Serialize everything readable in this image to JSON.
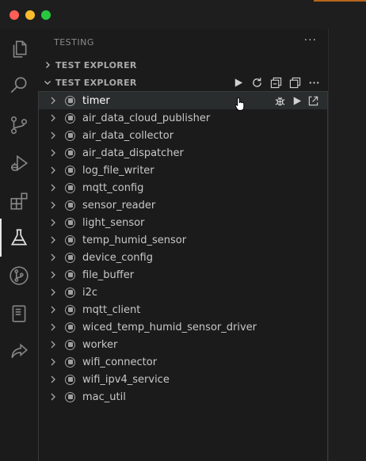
{
  "window": {
    "traffic_lights": [
      "close",
      "minimize",
      "maximize"
    ],
    "colors": {
      "close": "#ff5f57",
      "minimize": "#febc2e",
      "maximize": "#28c840"
    }
  },
  "activity_bar": {
    "items": [
      {
        "icon": "files-icon",
        "active": false
      },
      {
        "icon": "search-icon",
        "active": false
      },
      {
        "icon": "source-control-icon",
        "active": false
      },
      {
        "icon": "run-debug-icon",
        "active": false
      },
      {
        "icon": "extensions-icon",
        "active": false
      },
      {
        "icon": "testing-flask-icon",
        "active": true
      },
      {
        "icon": "git-graph-icon",
        "active": false
      },
      {
        "icon": "notebook-icon",
        "active": false
      },
      {
        "icon": "live-share-icon",
        "active": false
      }
    ]
  },
  "sidebar": {
    "title": "TESTING",
    "more": "···",
    "sections": [
      {
        "label": "TEST EXPLORER",
        "expanded": false
      },
      {
        "label": "TEST EXPLORER",
        "expanded": true
      }
    ],
    "section_actions": [
      "run-icon",
      "refresh-icon",
      "collapse-all-icon",
      "show-output-icon",
      "more-actions-icon"
    ],
    "more_actions": "···",
    "tests": [
      {
        "name": "timer",
        "selected": true
      },
      {
        "name": "air_data_cloud_publisher"
      },
      {
        "name": "air_data_collector"
      },
      {
        "name": "air_data_dispatcher"
      },
      {
        "name": "log_file_writer"
      },
      {
        "name": "mqtt_config"
      },
      {
        "name": "sensor_reader"
      },
      {
        "name": "light_sensor"
      },
      {
        "name": "temp_humid_sensor"
      },
      {
        "name": "device_config"
      },
      {
        "name": "file_buffer"
      },
      {
        "name": "i2c"
      },
      {
        "name": "mqtt_client"
      },
      {
        "name": "wiced_temp_humid_sensor_driver"
      },
      {
        "name": "worker"
      },
      {
        "name": "wifi_connector"
      },
      {
        "name": "wifi_ipv4_service"
      },
      {
        "name": "mac_util"
      }
    ],
    "row_actions": [
      "debug-test-icon",
      "run-test-icon",
      "go-to-test-icon"
    ]
  },
  "colors": {
    "accent": "#b5651d",
    "selected_row": "#2a2d2e",
    "text": "#cccccc"
  }
}
